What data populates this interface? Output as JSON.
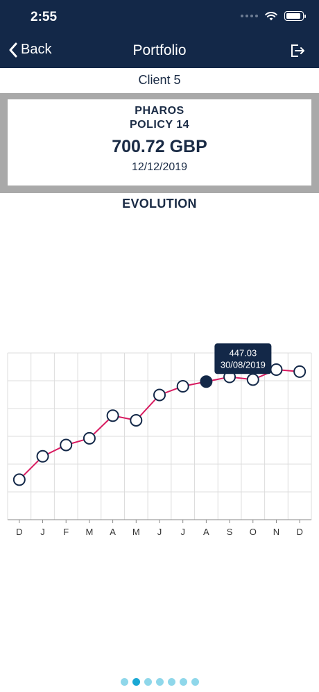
{
  "status": {
    "time": "2:55"
  },
  "header": {
    "back_label": "Back",
    "title": "Portfolio"
  },
  "client": {
    "label": "Client  5"
  },
  "policy": {
    "company": "PHAROS",
    "name": "POLICY 14",
    "amount": "700.72 GBP",
    "date": "12/12/2019"
  },
  "section": {
    "title": "EVOLUTION"
  },
  "tooltip": {
    "value": "447.03",
    "date": "30/08/2019"
  },
  "colors": {
    "header": "#132848",
    "line": "#d81b60",
    "selected_point": "#132848",
    "pager_active": "#1aa8d4",
    "pager_inactive": "#8fd7ea"
  },
  "chart_data": {
    "type": "line",
    "categories": [
      "D",
      "J",
      "F",
      "M",
      "A",
      "M",
      "J",
      "J",
      "A",
      "S",
      "O",
      "N",
      "D"
    ],
    "values": [
      300,
      335,
      352,
      362,
      396,
      389,
      427,
      440,
      447.03,
      454,
      450,
      465,
      462
    ],
    "selected_index": 8,
    "ylim": [
      240,
      490
    ],
    "grid": true
  },
  "pager": {
    "count": 7,
    "active": 1
  }
}
